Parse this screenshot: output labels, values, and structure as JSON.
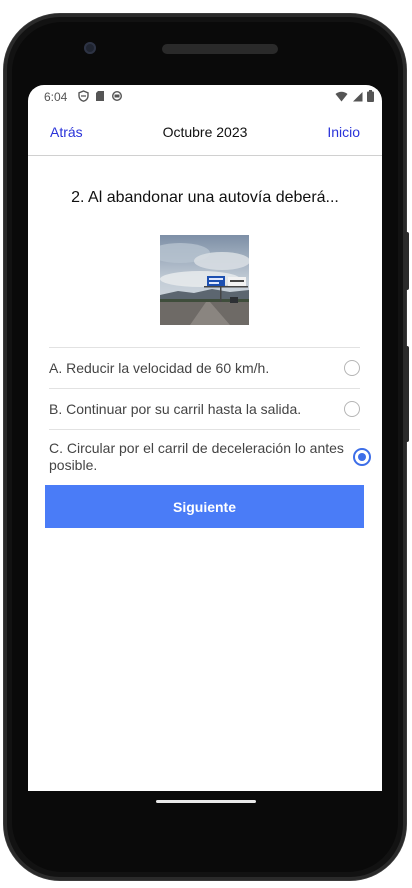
{
  "status": {
    "time": "6:04",
    "icons": [
      "shield-icon",
      "sd-card-icon",
      "sync-icon"
    ],
    "right_icons": [
      "wifi-icon",
      "signal-icon",
      "battery-icon"
    ]
  },
  "nav": {
    "back_label": "Atrás",
    "title": "Octubre 2023",
    "home_label": "Inicio"
  },
  "question": {
    "text": "2. Al abandonar una autovía deberá..."
  },
  "options": [
    {
      "label": "A. Reducir la velocidad de 60 km/h.",
      "selected": false
    },
    {
      "label": "B. Continuar por su carril hasta la salida.",
      "selected": false
    },
    {
      "label": "C. Circular por el carril de deceleración lo antes posible.",
      "selected": true
    }
  ],
  "next_button": {
    "label": "Siguiente"
  },
  "colors": {
    "accent": "#4a7cf7",
    "link": "#2a33d9",
    "radio_selected": "#3d6ee8"
  }
}
